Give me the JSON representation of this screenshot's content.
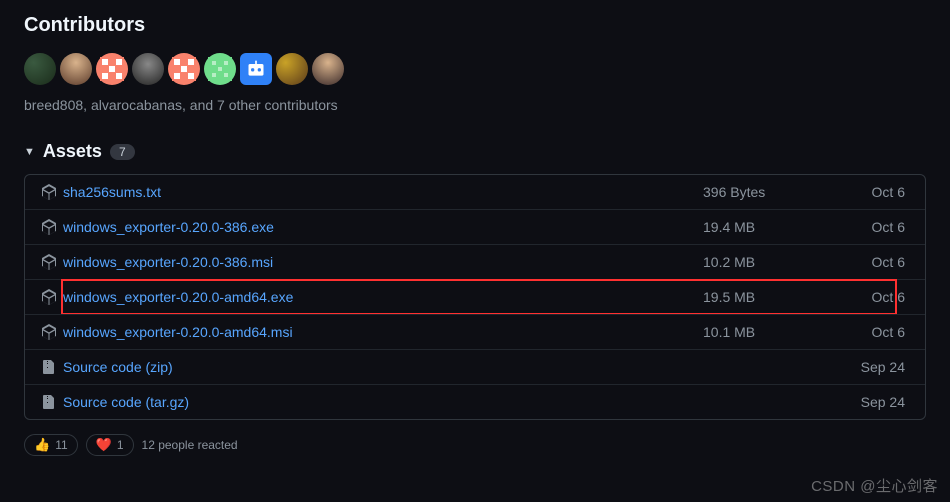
{
  "contributors": {
    "title": "Contributors",
    "summary": "breed808, alvarocabanas, and 7 other contributors"
  },
  "assets": {
    "title": "Assets",
    "count": "7",
    "items": [
      {
        "name": "sha256sums.txt",
        "size": "396 Bytes",
        "date": "Oct 6",
        "icon": "package",
        "highlighted": false
      },
      {
        "name": "windows_exporter-0.20.0-386.exe",
        "size": "19.4 MB",
        "date": "Oct 6",
        "icon": "package",
        "highlighted": false
      },
      {
        "name": "windows_exporter-0.20.0-386.msi",
        "size": "10.2 MB",
        "date": "Oct 6",
        "icon": "package",
        "highlighted": false
      },
      {
        "name": "windows_exporter-0.20.0-amd64.exe",
        "size": "19.5 MB",
        "date": "Oct 6",
        "icon": "package",
        "highlighted": true
      },
      {
        "name": "windows_exporter-0.20.0-amd64.msi",
        "size": "10.1 MB",
        "date": "Oct 6",
        "icon": "package",
        "highlighted": false
      },
      {
        "name": "Source code",
        "format": "(zip)",
        "size": "",
        "date": "Sep 24",
        "icon": "zip",
        "highlighted": false
      },
      {
        "name": "Source code",
        "format": "(tar.gz)",
        "size": "",
        "date": "Sep 24",
        "icon": "zip",
        "highlighted": false
      }
    ]
  },
  "reactions": {
    "thumbs_up_count": "11",
    "heart_count": "1",
    "summary": "12 people reacted"
  },
  "watermark": "CSDN @尘心剑客"
}
